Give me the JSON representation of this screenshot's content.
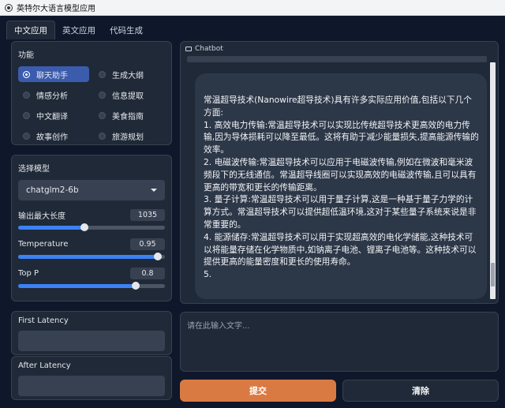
{
  "window": {
    "title": "英特尔大语言模型应用"
  },
  "tabs": [
    {
      "label": "中文应用",
      "active": true
    },
    {
      "label": "英文应用",
      "active": false
    },
    {
      "label": "代码生成",
      "active": false
    }
  ],
  "function_panel": {
    "label": "功能",
    "options": [
      {
        "label": "聊天助手",
        "selected": true
      },
      {
        "label": "生成大纲",
        "selected": false
      },
      {
        "label": "情感分析",
        "selected": false
      },
      {
        "label": "信息提取",
        "selected": false
      },
      {
        "label": "中文翻译",
        "selected": false
      },
      {
        "label": "美食指南",
        "selected": false
      },
      {
        "label": "故事创作",
        "selected": false
      },
      {
        "label": "旅游规划",
        "selected": false
      }
    ]
  },
  "model_panel": {
    "label": "选择模型",
    "selected_model": "chatglm2-6b",
    "max_length": {
      "label": "输出最大长度",
      "value": "1035",
      "fraction": 0.45
    },
    "temperature": {
      "label": "Temperature",
      "value": "0.95",
      "fraction": 0.95
    },
    "top_p": {
      "label": "Top P",
      "value": "0.8",
      "fraction": 0.8
    }
  },
  "latency": {
    "first_label": "First Latency",
    "first_value": "",
    "after_label": "After Latency",
    "after_value": ""
  },
  "chatbot": {
    "label": "Chatbot",
    "message": "常温超导技术(Nanowire超导技术)具有许多实际应用价值,包括以下几个方面:\n1. 高效电力传输:常温超导技术可以实现比传统超导技术更高效的电力传输,因为导体损耗可以降至最低。这将有助于减少能量损失,提高能源传输的效率。\n2. 电磁波传输:常温超导技术可以应用于电磁波传输,例如在微波和毫米波频段下的无线通信。常温超导线圈可以实现高效的电磁波传输,且可以具有更高的带宽和更长的传输距离。\n3. 量子计算:常温超导技术可以用于量子计算,这是一种基于量子力学的计算方式。常温超导技术可以提供超低温环境,这对于某些量子系统来说是非常重要的。\n4. 能源储存:常温超导技术可以用于实现超高效的电化学储能,这种技术可以将能量存储在化学物质中,如钠离子电池、锂离子电池等。这种技术可以提供更高的能量密度和更长的使用寿命。\n5."
  },
  "input": {
    "placeholder": "请在此输入文字...",
    "value": ""
  },
  "buttons": {
    "submit_label": "提交",
    "clear_label": "清除"
  },
  "colors": {
    "accent": "#3b5bad",
    "submit": "#d97a43",
    "background": "#0f172a",
    "panel": "#1f2937"
  }
}
